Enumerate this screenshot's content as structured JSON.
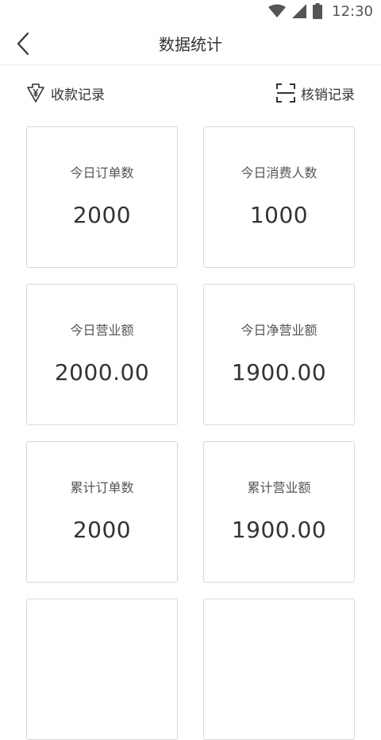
{
  "status_bar": {
    "time": "12:30",
    "icons": [
      "wifi-icon",
      "signal-icon",
      "battery-icon"
    ]
  },
  "header": {
    "title": "数据统计",
    "back_icon": "chevron-left-icon"
  },
  "actions": {
    "receipts": {
      "label": "收款记录",
      "icon": "yen-download-icon"
    },
    "verification": {
      "label": "核销记录",
      "icon": "scan-frame-icon"
    }
  },
  "stats": [
    {
      "label": "今日订单数",
      "value": "2000"
    },
    {
      "label": "今日消费人数",
      "value": "1000"
    },
    {
      "label": "今日营业额",
      "value": "2000.00"
    },
    {
      "label": "今日净营业额",
      "value": "1900.00"
    },
    {
      "label": "累计订单数",
      "value": "2000"
    },
    {
      "label": "累计营业额",
      "value": "1900.00"
    },
    {
      "label": "",
      "value": ""
    },
    {
      "label": "",
      "value": ""
    }
  ],
  "colors": {
    "text": "#333333",
    "label": "#555555",
    "border": "#d9d9d9",
    "background": "#ffffff"
  }
}
